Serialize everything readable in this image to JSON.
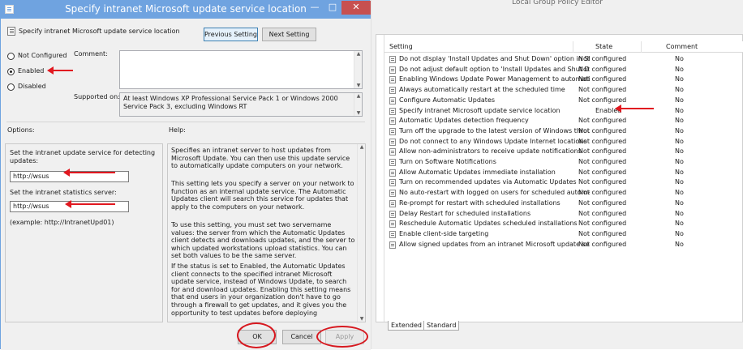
{
  "background_window": {
    "title": "Local Group Policy Editor",
    "columns": {
      "setting": "Setting",
      "state": "State",
      "comment": "Comment"
    },
    "rows": [
      {
        "name": "Do not display 'Install Updates and Shut Down' option in Sh...",
        "state": "Not configured",
        "comment": "No"
      },
      {
        "name": "Do not adjust default option to 'Install Updates and Shut Do...",
        "state": "Not configured",
        "comment": "No"
      },
      {
        "name": "Enabling Windows Update Power Management to automati...",
        "state": "Not configured",
        "comment": "No"
      },
      {
        "name": "Always automatically restart at the scheduled time",
        "state": "Not configured",
        "comment": "No"
      },
      {
        "name": "Configure Automatic Updates",
        "state": "Not configured",
        "comment": "No"
      },
      {
        "name": "Specify intranet Microsoft update service location",
        "state": "Enabled",
        "comment": "No"
      },
      {
        "name": "Automatic Updates detection frequency",
        "state": "Not configured",
        "comment": "No"
      },
      {
        "name": "Turn off the upgrade to the latest version of Windows throu...",
        "state": "Not configured",
        "comment": "No"
      },
      {
        "name": "Do not connect to any Windows Update Internet locations",
        "state": "Not configured",
        "comment": "No"
      },
      {
        "name": "Allow non-administrators to receive update notifications",
        "state": "Not configured",
        "comment": "No"
      },
      {
        "name": "Turn on Software Notifications",
        "state": "Not configured",
        "comment": "No"
      },
      {
        "name": "Allow Automatic Updates immediate installation",
        "state": "Not configured",
        "comment": "No"
      },
      {
        "name": "Turn on recommended updates via Automatic Updates",
        "state": "Not configured",
        "comment": "No"
      },
      {
        "name": "No auto-restart with logged on users for scheduled automat...",
        "state": "Not configured",
        "comment": "No"
      },
      {
        "name": "Re-prompt for restart with scheduled installations",
        "state": "Not configured",
        "comment": "No"
      },
      {
        "name": "Delay Restart for scheduled installations",
        "state": "Not configured",
        "comment": "No"
      },
      {
        "name": "Reschedule Automatic Updates scheduled installations",
        "state": "Not configured",
        "comment": "No"
      },
      {
        "name": "Enable client-side targeting",
        "state": "Not configured",
        "comment": "No"
      },
      {
        "name": "Allow signed updates from an intranet Microsoft update ser...",
        "state": "Not configured",
        "comment": "No"
      }
    ],
    "tabs": [
      "Extended",
      "Standard"
    ]
  },
  "dialog": {
    "title": "Specify intranet Microsoft update service location",
    "window_buttons": {
      "minimize": "—",
      "maximize": "□",
      "close": "✕"
    },
    "policy_name": "Specify intranet Microsoft update service location",
    "prev_button": "Previous Setting",
    "next_button": "Next Setting",
    "radios": [
      {
        "label": "Not Configured",
        "selected": false
      },
      {
        "label": "Enabled",
        "selected": true
      },
      {
        "label": "Disabled",
        "selected": false
      }
    ],
    "comment_label": "Comment:",
    "supported_label": "Supported on:",
    "supported_text": "At least Windows XP Professional Service Pack 1 or Windows 2000 Service Pack 3, excluding Windows RT",
    "options_label": "Options:",
    "help_label": "Help:",
    "options": {
      "detect_label": "Set the intranet update service for detecting updates:",
      "detect_value": "http://wsus",
      "stats_label": "Set the intranet statistics server:",
      "stats_value": "http://wsus",
      "example": "(example: http://IntranetUpd01)"
    },
    "help_paragraphs": [
      "Specifies an intranet server to host updates from Microsoft Update. You can then use this update service to automatically update computers on your network.",
      "This setting lets you specify a server on your network to function as an internal update service. The Automatic Updates client will search this service for updates that apply to the computers on your network.",
      "To use this setting, you must set two servername values: the server from which the Automatic Updates client detects and downloads updates, and the server to which updated workstations upload statistics. You can set both values to be the same server.",
      "If the status is set to Enabled, the Automatic Updates client connects to the specified intranet Microsoft update service, instead of Windows Update, to search for and download updates. Enabling this setting means that end users in your organization don't have to go through a firewall to get updates, and it gives you the opportunity to test updates before deploying"
    ],
    "ok_button": "OK",
    "cancel_button": "Cancel",
    "apply_button": "Apply"
  },
  "colors": {
    "titlebar": "#6fa3e0",
    "annotation": "#e11820",
    "close": "#c75050"
  }
}
